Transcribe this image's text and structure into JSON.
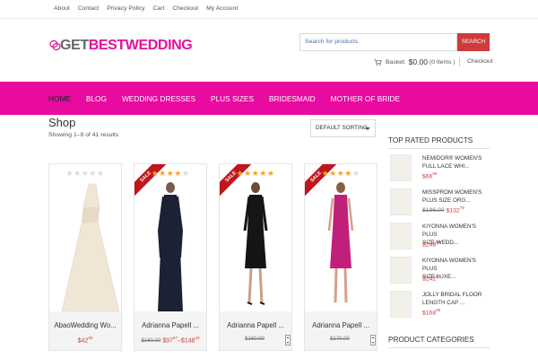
{
  "topbar": {
    "links": [
      "About",
      "Contact",
      "Privacy Policy",
      "Cart",
      "Checkout",
      "My Account"
    ]
  },
  "header": {
    "logo_get": "GET",
    "logo_best": "BEST",
    "logo_wedding": "WEDDING",
    "search_placeholder": "Search for products",
    "search_button": "SEARCH",
    "basket_label": "Basket:",
    "basket_amount": "$0.00",
    "basket_items": "(0 Items )",
    "checkout": "Checkout"
  },
  "nav": {
    "items": [
      "HOME",
      "BLOG",
      "WEDDING DRESSES",
      "PLUS SIZES",
      "BRIDESMAID",
      "MOTHER OF BRIDE"
    ],
    "active": 0
  },
  "shop": {
    "title": "Shop",
    "results": "Showing 1–9 of 41 results",
    "sorting": "DEFAULT SORTING"
  },
  "products": [
    {
      "name": "AbaoWedding Wo...",
      "price_old": "",
      "price": "$42",
      "price_cents": "00",
      "price_to": "",
      "price_to_cents": "",
      "rating": 0,
      "sale": false,
      "sale_label": ""
    },
    {
      "name": "Adrianna Papell ...",
      "price_old": "$160.00",
      "price": "$97",
      "price_cents": "67",
      "price_to": "$148",
      "price_to_cents": "43",
      "rating": 4,
      "sale": true,
      "sale_label": "SALE"
    },
    {
      "name": "Adrianna Papell ...",
      "price_old": "$160.00",
      "price": "",
      "price_cents": "",
      "price_to": "",
      "price_to_cents": "",
      "rating": 5,
      "sale": true,
      "sale_label": "SALE"
    },
    {
      "name": "Adrianna Papell ...",
      "price_old": "$170.00",
      "price": "",
      "price_cents": "",
      "price_to": "",
      "price_to_cents": "",
      "rating": 4,
      "sale": true,
      "sale_label": "SALE"
    }
  ],
  "sidebar": {
    "top_rated_title": "TOP RATED PRODUCTS",
    "items": [
      {
        "line1": "NEMIDOR® WOMEN'S",
        "line2": "FULL LACE WHI...",
        "price_old": "",
        "price": "$66",
        "cents": "99"
      },
      {
        "line1": "MISSPROM WOMEN'S",
        "line2": "PLUS SIZE ORG...",
        "price_old": "$196.00",
        "price": "$132",
        "cents": "79"
      },
      {
        "line1": "KIYONNA WOMEN'S PLUS",
        "line2": "SIZE WEDD...",
        "price_old": "",
        "price": "$248",
        "cents": "00"
      },
      {
        "line1": "KIYONNA WOMEN'S PLUS",
        "line2": "SIZE LUXE...",
        "price_old": "",
        "price": "$242",
        "cents": "00"
      },
      {
        "line1": "JOLLY BRIDAL FLOOR",
        "line2": "LENGTH CAP ...",
        "price_old": "",
        "price": "$168",
        "cents": "99"
      }
    ],
    "categories_title": "PRODUCT CATEGORIES"
  },
  "colors": {
    "accent_pink": "#e90aa0",
    "sale_red": "#c0151c",
    "price_red": "#c93e3e",
    "star_gold": "#f1a22c"
  },
  "icons": {
    "cart": "cart-icon",
    "star": "star-icon",
    "dropdown": "chevron-down-icon"
  }
}
